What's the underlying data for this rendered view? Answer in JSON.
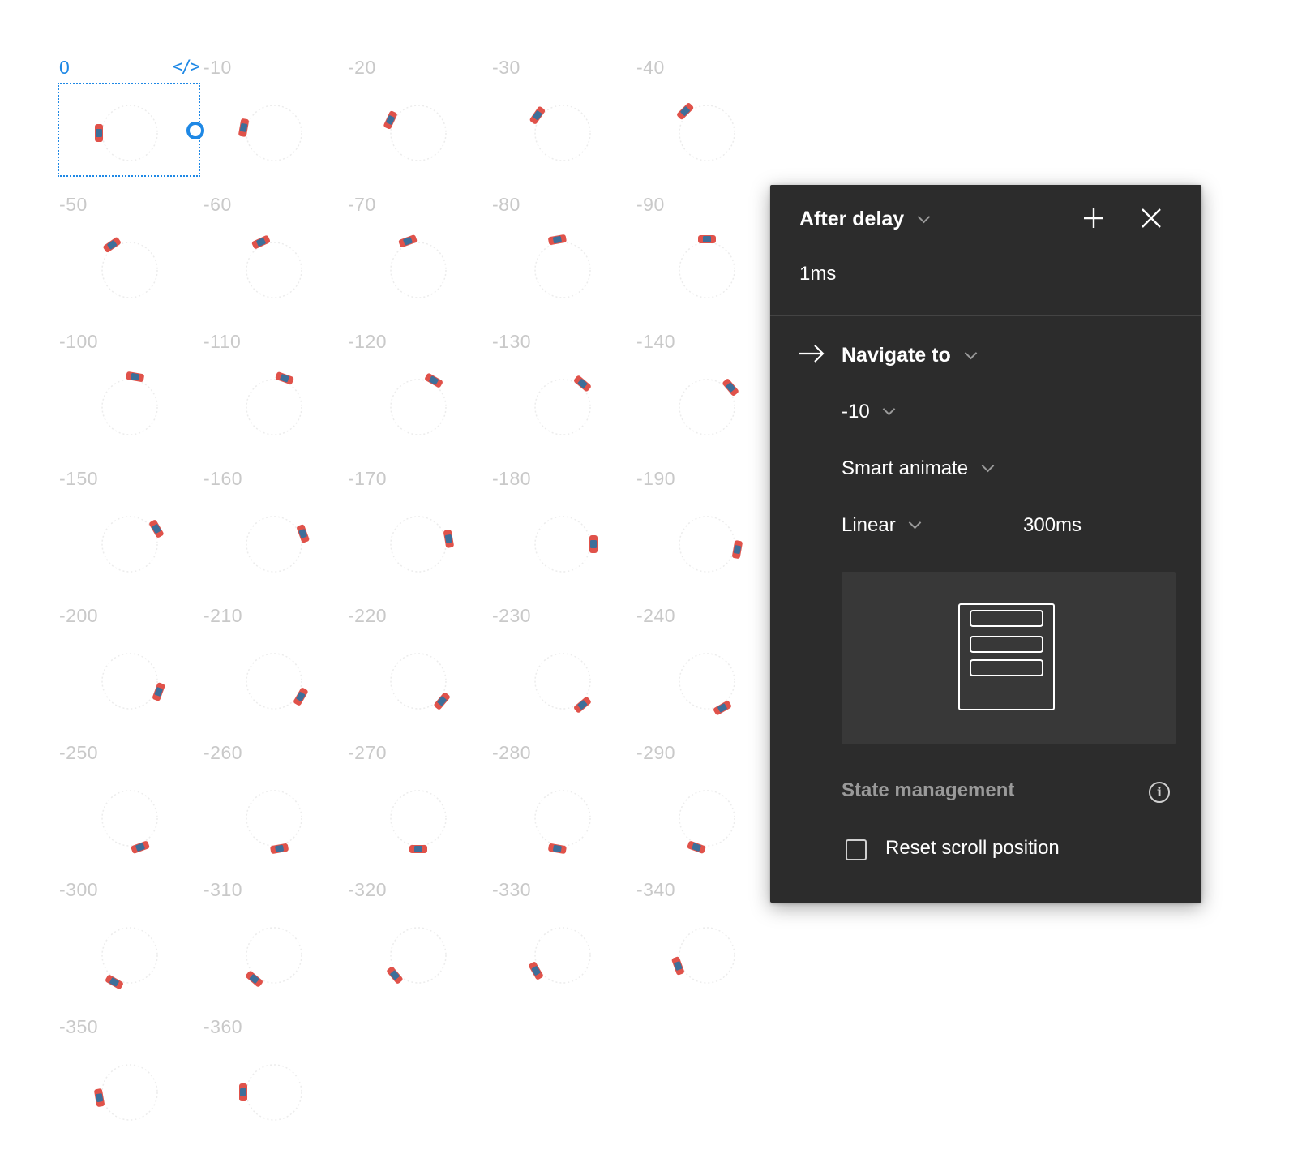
{
  "canvas": {
    "frames": [
      {
        "label": "0",
        "car_angle_deg": 0
      },
      {
        "label": "-10",
        "car_angle_deg": 10
      },
      {
        "label": "-20",
        "car_angle_deg": 25
      },
      {
        "label": "-30",
        "car_angle_deg": 35
      },
      {
        "label": "-40",
        "car_angle_deg": 45
      },
      {
        "label": "-50",
        "car_angle_deg": 55
      },
      {
        "label": "-60",
        "car_angle_deg": 65
      },
      {
        "label": "-70",
        "car_angle_deg": 70
      },
      {
        "label": "-80",
        "car_angle_deg": 80
      },
      {
        "label": "-90",
        "car_angle_deg": 90
      },
      {
        "label": "-100",
        "car_angle_deg": 100
      },
      {
        "label": "-110",
        "car_angle_deg": 110
      },
      {
        "label": "-120",
        "car_angle_deg": 120
      },
      {
        "label": "-130",
        "car_angle_deg": 130
      },
      {
        "label": "-140",
        "car_angle_deg": 140
      },
      {
        "label": "-150",
        "car_angle_deg": 150
      },
      {
        "label": "-160",
        "car_angle_deg": 160
      },
      {
        "label": "-170",
        "car_angle_deg": 170
      },
      {
        "label": "-180",
        "car_angle_deg": 180
      },
      {
        "label": "-190",
        "car_angle_deg": 190
      },
      {
        "label": "-200",
        "car_angle_deg": 200
      },
      {
        "label": "-210",
        "car_angle_deg": 210
      },
      {
        "label": "-220",
        "car_angle_deg": 220
      },
      {
        "label": "-230",
        "car_angle_deg": 230
      },
      {
        "label": "-240",
        "car_angle_deg": 240
      },
      {
        "label": "-250",
        "car_angle_deg": 250
      },
      {
        "label": "-260",
        "car_angle_deg": 260
      },
      {
        "label": "-270",
        "car_angle_deg": 270
      },
      {
        "label": "-280",
        "car_angle_deg": 280
      },
      {
        "label": "-290",
        "car_angle_deg": 290
      },
      {
        "label": "-300",
        "car_angle_deg": 300
      },
      {
        "label": "-310",
        "car_angle_deg": 310
      },
      {
        "label": "-320",
        "car_angle_deg": 320
      },
      {
        "label": "-330",
        "car_angle_deg": 330
      },
      {
        "label": "-340",
        "car_angle_deg": 340
      },
      {
        "label": "-350",
        "car_angle_deg": 350
      },
      {
        "label": "-360",
        "car_angle_deg": 360
      }
    ],
    "selected_frame": "0",
    "selection_color": "#1e88e5",
    "car_colors": {
      "body": "#e0524a",
      "roof": "#3d6f9a"
    }
  },
  "panel": {
    "trigger": "After delay",
    "delay": "1ms",
    "action": "Navigate to",
    "destination": "-10",
    "animation": "Smart animate",
    "easing": "Linear",
    "duration": "300ms",
    "state_management_label": "State management",
    "reset_scroll_label": "Reset scroll position",
    "reset_scroll_checked": false,
    "icons": {
      "add": "plus-icon",
      "close": "close-icon",
      "action": "arrow-right-icon",
      "info": "info-icon"
    }
  }
}
